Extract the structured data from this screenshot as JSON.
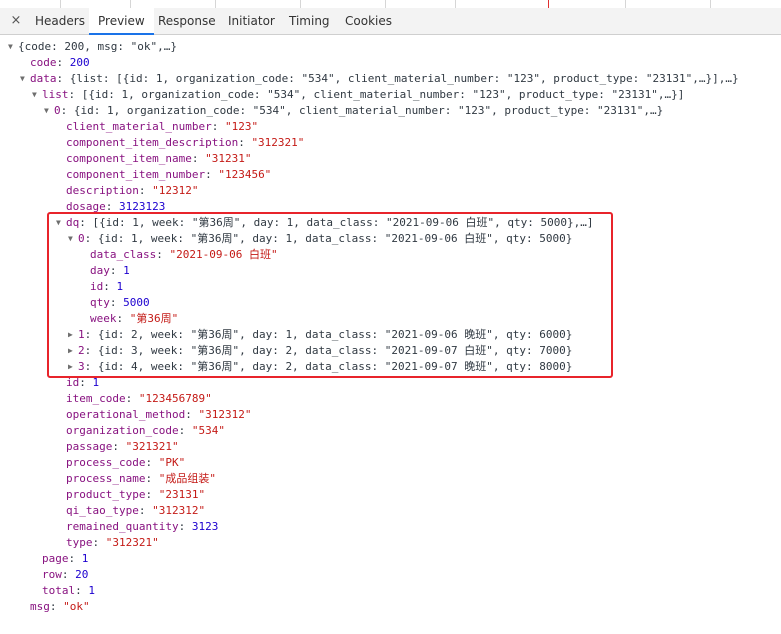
{
  "colors": {
    "key": "#881280",
    "string": "#c41a16",
    "number": "#1c00cf",
    "highlight": "#e8242b",
    "active_tab": "#1a73e8"
  },
  "tabs": [
    {
      "label": "Headers",
      "active": false
    },
    {
      "label": "Preview",
      "active": true
    },
    {
      "label": "Response",
      "active": false
    },
    {
      "label": "Initiator",
      "active": false
    },
    {
      "label": "Timing",
      "active": false
    },
    {
      "label": "Cookies",
      "active": false
    }
  ],
  "close_icon": "×",
  "tree": [
    {
      "indent": 0,
      "arrow": "down",
      "text": "{code: 200, msg: \"ok\",…}"
    },
    {
      "indent": 1,
      "key": "code",
      "value": "200",
      "vtype": "number"
    },
    {
      "indent": 1,
      "arrow": "down",
      "key": "data",
      "summary": "{list: [{id: 1, organization_code: \"534\", client_material_number: \"123\", product_type: \"23131\",…}],…}"
    },
    {
      "indent": 2,
      "arrow": "down",
      "key": "list",
      "summary": "[{id: 1, organization_code: \"534\", client_material_number: \"123\", product_type: \"23131\",…}]"
    },
    {
      "indent": 3,
      "arrow": "down",
      "key": "0",
      "summary": "{id: 1, organization_code: \"534\", client_material_number: \"123\", product_type: \"23131\",…}"
    },
    {
      "indent": 4,
      "key": "client_material_number",
      "value": "\"123\"",
      "vtype": "string"
    },
    {
      "indent": 4,
      "key": "component_item_description",
      "value": "\"312321\"",
      "vtype": "string"
    },
    {
      "indent": 4,
      "key": "component_item_name",
      "value": "\"31231\"",
      "vtype": "string"
    },
    {
      "indent": 4,
      "key": "component_item_number",
      "value": "\"123456\"",
      "vtype": "string"
    },
    {
      "indent": 4,
      "key": "description",
      "value": "\"12312\"",
      "vtype": "string"
    },
    {
      "indent": 4,
      "key": "dosage",
      "value": "3123123",
      "vtype": "number"
    },
    {
      "indent": 4,
      "arrow": "down",
      "key": "dq",
      "summary": "[{id: 1, week: \"第36周\", day: 1, data_class: \"2021-09-06 白班\", qty: 5000},…]"
    },
    {
      "indent": 5,
      "arrow": "down",
      "key": "0",
      "summary": "{id: 1, week: \"第36周\", day: 1, data_class: \"2021-09-06 白班\", qty: 5000}"
    },
    {
      "indent": 6,
      "key": "data_class",
      "value": "\"2021-09-06 白班\"",
      "vtype": "string"
    },
    {
      "indent": 6,
      "key": "day",
      "value": "1",
      "vtype": "number"
    },
    {
      "indent": 6,
      "key": "id",
      "value": "1",
      "vtype": "number"
    },
    {
      "indent": 6,
      "key": "qty",
      "value": "5000",
      "vtype": "number"
    },
    {
      "indent": 6,
      "key": "week",
      "value": "\"第36周\"",
      "vtype": "string"
    },
    {
      "indent": 5,
      "arrow": "right",
      "key": "1",
      "summary": "{id: 2, week: \"第36周\", day: 1, data_class: \"2021-09-06 晚班\", qty: 6000}"
    },
    {
      "indent": 5,
      "arrow": "right",
      "key": "2",
      "summary": "{id: 3, week: \"第36周\", day: 2, data_class: \"2021-09-07 白班\", qty: 7000}"
    },
    {
      "indent": 5,
      "arrow": "right",
      "key": "3",
      "summary": "{id: 4, week: \"第36周\", day: 2, data_class: \"2021-09-07 晚班\", qty: 8000}"
    },
    {
      "indent": 4,
      "key": "id",
      "value": "1",
      "vtype": "number"
    },
    {
      "indent": 4,
      "key": "item_code",
      "value": "\"123456789\"",
      "vtype": "string"
    },
    {
      "indent": 4,
      "key": "operational_method",
      "value": "\"312312\"",
      "vtype": "string"
    },
    {
      "indent": 4,
      "key": "organization_code",
      "value": "\"534\"",
      "vtype": "string"
    },
    {
      "indent": 4,
      "key": "passage",
      "value": "\"321321\"",
      "vtype": "string"
    },
    {
      "indent": 4,
      "key": "process_code",
      "value": "\"PK\"",
      "vtype": "string"
    },
    {
      "indent": 4,
      "key": "process_name",
      "value": "\"成品组装\"",
      "vtype": "string"
    },
    {
      "indent": 4,
      "key": "product_type",
      "value": "\"23131\"",
      "vtype": "string"
    },
    {
      "indent": 4,
      "key": "qi_tao_type",
      "value": "\"312312\"",
      "vtype": "string"
    },
    {
      "indent": 4,
      "key": "remained_quantity",
      "value": "3123",
      "vtype": "number"
    },
    {
      "indent": 4,
      "key": "type",
      "value": "\"312321\"",
      "vtype": "string"
    },
    {
      "indent": 2,
      "key": "page",
      "value": "1",
      "vtype": "number"
    },
    {
      "indent": 2,
      "key": "row",
      "value": "20",
      "vtype": "number"
    },
    {
      "indent": 2,
      "key": "total",
      "value": "1",
      "vtype": "number"
    },
    {
      "indent": 1,
      "key": "msg",
      "value": "\"ok\"",
      "vtype": "string"
    }
  ]
}
